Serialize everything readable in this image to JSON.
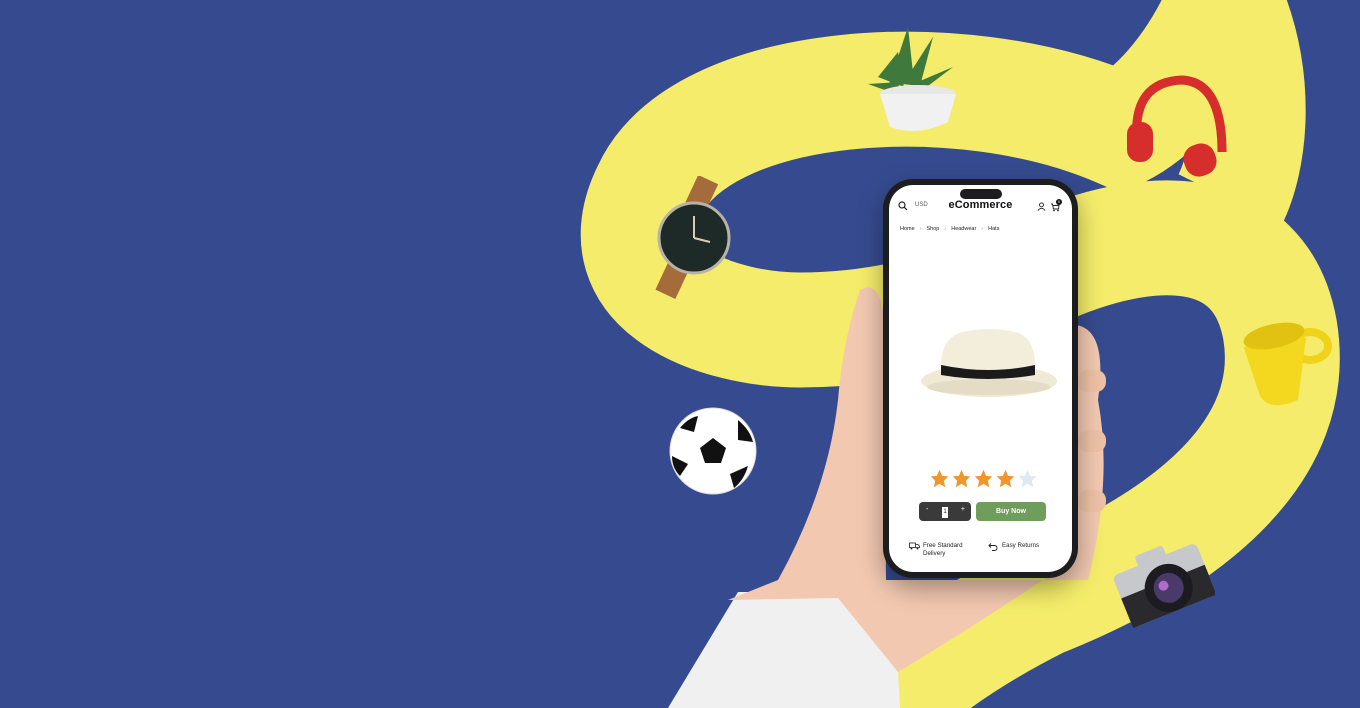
{
  "header": {
    "currency": "USD",
    "brand": "eCommerce",
    "cart_count": "0"
  },
  "breadcrumb": [
    "Home",
    "Shop",
    "Headwear",
    "Hats"
  ],
  "product": {
    "rating": 4,
    "rating_max": 5,
    "quantity": "1",
    "qty_minus": "-",
    "qty_plus": "+",
    "buy_label": "Buy Now"
  },
  "features": {
    "delivery_line1": "Free Standard",
    "delivery_line2": "Delivery",
    "returns": "Easy Returns"
  },
  "colors": {
    "background": "#364b8f",
    "ribbon": "#f4ec6a",
    "buy_button": "#6f9e5c",
    "star": "#f2962b"
  },
  "icons": [
    "search-icon",
    "user-icon",
    "cart-icon",
    "truck-icon",
    "return-icon",
    "star-icon"
  ]
}
